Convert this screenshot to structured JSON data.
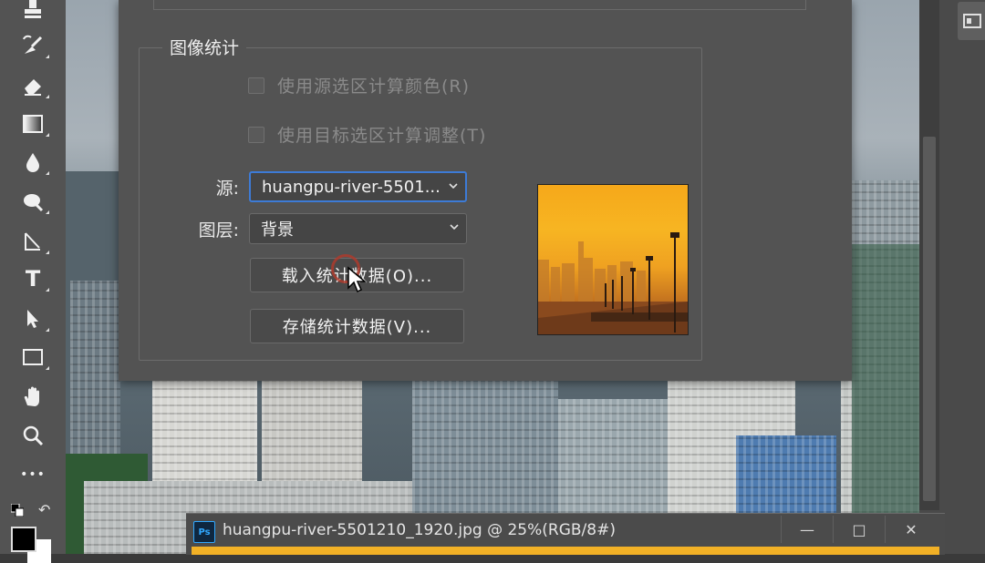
{
  "dialog": {
    "group_title": "图像统计",
    "checkbox_source_selection": "使用源选区计算颜色(R)",
    "checkbox_target_selection": "使用目标选区计算调整(T)",
    "source_label": "源:",
    "source_value": "huangpu-river-5501...",
    "layer_label": "图层:",
    "layer_value": "背景",
    "load_stats_button": "载入统计数据(O)...",
    "save_stats_button": "存储统计数据(V)..."
  },
  "document": {
    "title": "huangpu-river-5501210_1920.jpg @ 25%(RGB/8#)",
    "app_badge": "Ps",
    "minimize": "—",
    "maximize": "□",
    "close": "✕"
  },
  "toolbar": {
    "tools": [
      "stamp-icon",
      "history-brush-icon",
      "eraser-icon",
      "gradient-icon",
      "blur-drop-icon",
      "dodge-icon",
      "pen-icon",
      "type-icon",
      "path-select-icon",
      "rectangle-icon",
      "hand-icon",
      "zoom-icon",
      "more-icon"
    ],
    "type_tool_glyph": "T",
    "more_glyph": "•••"
  },
  "colors": {
    "focus_blue": "#3d7bd6",
    "ps_blue": "#31a8ff",
    "cursor_ring": "#b33a2a"
  }
}
